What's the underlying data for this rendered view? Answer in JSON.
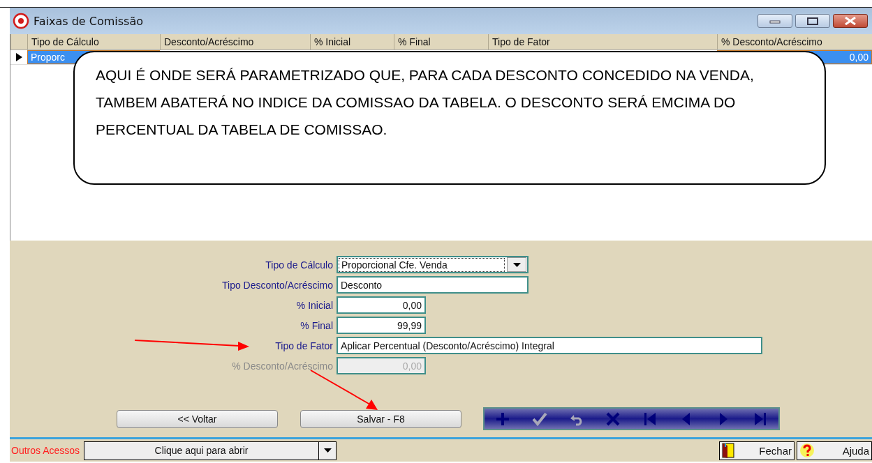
{
  "window": {
    "title": "Faixas de Comissão"
  },
  "grid": {
    "columns": [
      "Tipo de Cálculo",
      "Desconto/Acréscimo",
      "% Inicial",
      "% Final",
      "Tipo de Fator",
      "% Desconto/Acréscimo"
    ],
    "rows": [
      {
        "cells": [
          "Proporc",
          "",
          "",
          "",
          "",
          "0,00"
        ],
        "selected": true
      }
    ]
  },
  "callout": {
    "text": "AQUI É ONDE SERÁ PARAMETRIZADO QUE, PARA CADA DESCONTO CONCEDIDO NA VENDA,  TAMBEM ABATERÁ NO INDICE DA COMISSAO DA TABELA. O DESCONTO SERÁ EMCIMA DO PERCENTUAL DA TABELA DE COMISSAO."
  },
  "form": {
    "fields": [
      {
        "label": "Tipo de Cálculo",
        "kind": "combo",
        "value": "Proporcional Cfe. Venda",
        "disabled": false
      },
      {
        "label": "Tipo Desconto/Acréscimo",
        "kind": "text",
        "value": "Desconto",
        "disabled": false
      },
      {
        "label": "% Inicial",
        "kind": "number",
        "value": "0,00",
        "disabled": false
      },
      {
        "label": "% Final",
        "kind": "number",
        "value": "99,99",
        "disabled": false
      },
      {
        "label": "Tipo de Fator",
        "kind": "text",
        "value": "Aplicar Percentual (Desconto/Acréscimo) Integral",
        "disabled": false
      },
      {
        "label": "% Desconto/Acréscimo",
        "kind": "number",
        "value": "0,00",
        "disabled": true
      }
    ]
  },
  "buttons": [
    "<< Voltar",
    "Salvar - F8"
  ],
  "navigator": [
    {
      "kind": "add",
      "disabled": false
    },
    {
      "kind": "confirm",
      "disabled": true
    },
    {
      "kind": "undo",
      "disabled": true
    },
    {
      "kind": "delete",
      "disabled": false
    },
    {
      "kind": "first",
      "disabled": false
    },
    {
      "kind": "previous",
      "disabled": false
    },
    {
      "kind": "next",
      "disabled": false
    },
    {
      "kind": "last",
      "disabled": false
    }
  ],
  "bottom_bar": {
    "label": "Outros Acessos",
    "combo": {
      "value": "Clique aqui para abrir"
    },
    "buttons": [
      {
        "kind": "close",
        "label": "Fechar"
      },
      {
        "kind": "help",
        "label": "Ajuda"
      }
    ]
  }
}
